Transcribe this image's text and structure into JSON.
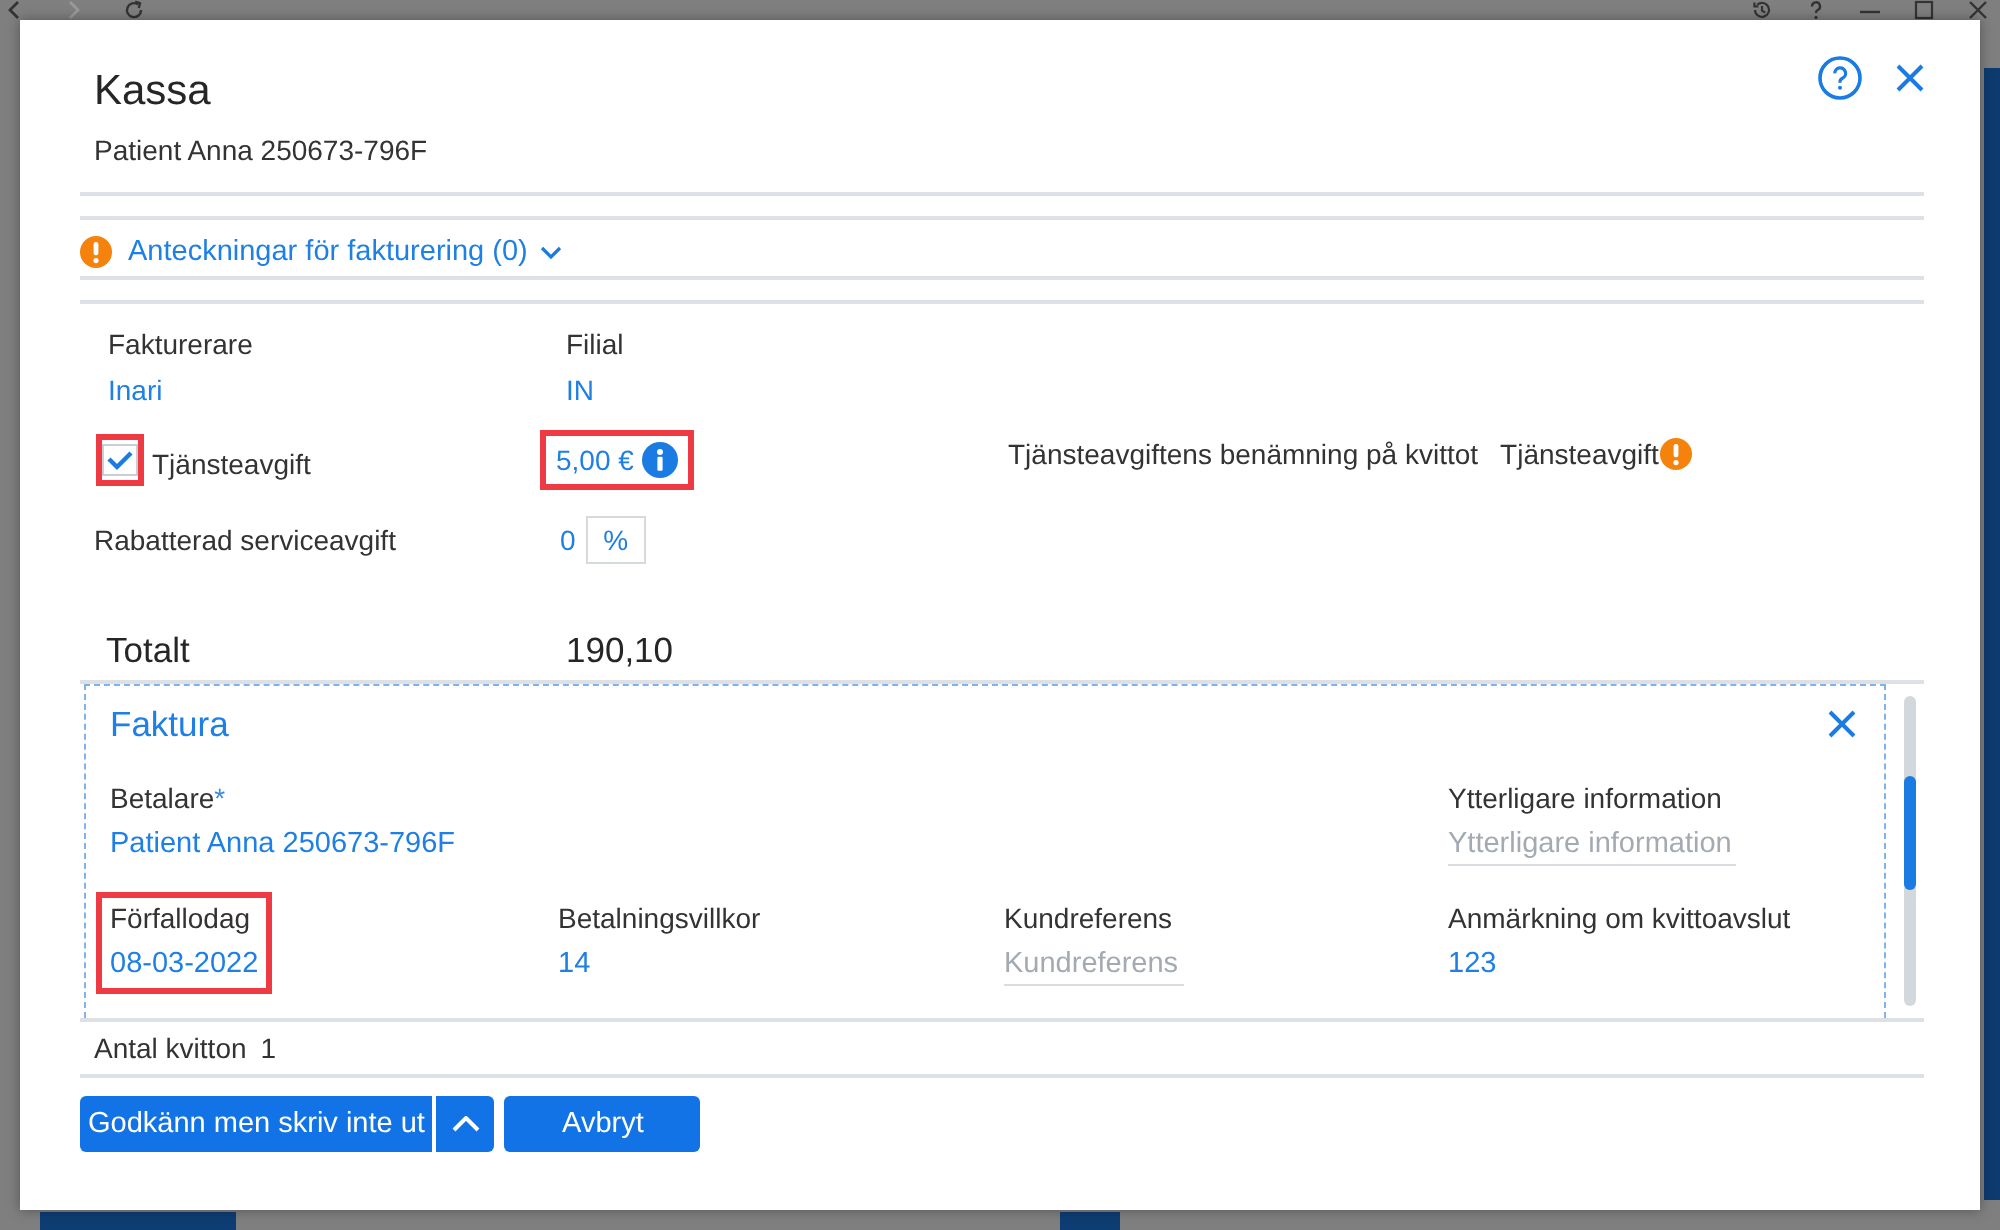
{
  "dialog": {
    "title": "Kassa",
    "subtitle": "Patient Anna 250673-796F",
    "notes": {
      "label": "Anteckningar för fakturering (0)",
      "expanded": false
    },
    "summary_fields": [
      {
        "label": "Fakturerare",
        "value": "Inari"
      },
      {
        "label": "Filial",
        "value": "IN"
      }
    ],
    "service_fee": {
      "label": "Tjänsteavgift",
      "checked": true,
      "checkbox_highlighted": true,
      "amount": "5,00 €",
      "amount_highlighted": true,
      "receipt_name_label": "Tjänsteavgiftens benämning på kvittot",
      "receipt_name": "Tjänsteavgift"
    },
    "discounted_fee": {
      "label": "Rabatterad serviceavgift",
      "value": "0",
      "unit": "%"
    },
    "total": {
      "label": "Totalt",
      "value": "190,10"
    },
    "invoice": {
      "title": "Faktura",
      "rows": [
        {
          "fields": [
            {
              "kind": "value",
              "label": "Betalare",
              "required_mark": "*",
              "value": "Patient Anna 250673-796F",
              "highlighted": false
            },
            {
              "kind": "input",
              "label": "Ytterligare information",
              "placeholder": "Ytterligare information",
              "highlighted": false
            }
          ]
        },
        {
          "fields": [
            {
              "kind": "value",
              "label": "Förfallodag",
              "value": "08-03-2022",
              "highlighted": true
            },
            {
              "kind": "value",
              "label": "Betalningsvillkor",
              "value": "14",
              "highlighted": false
            },
            {
              "kind": "input",
              "label": "Kundreferens",
              "placeholder": "Kundreferens",
              "highlighted": false
            },
            {
              "kind": "value",
              "label": "Anmärkning om kvittoavslut",
              "value": "123",
              "highlighted": false
            }
          ]
        }
      ]
    },
    "receipt_count": {
      "label": "Antal kvitton",
      "value": "1"
    },
    "buttons": [
      {
        "kind": "split",
        "label": "Godkänn men skriv inte ut"
      },
      {
        "kind": "plain",
        "label": "Avbryt"
      }
    ]
  }
}
